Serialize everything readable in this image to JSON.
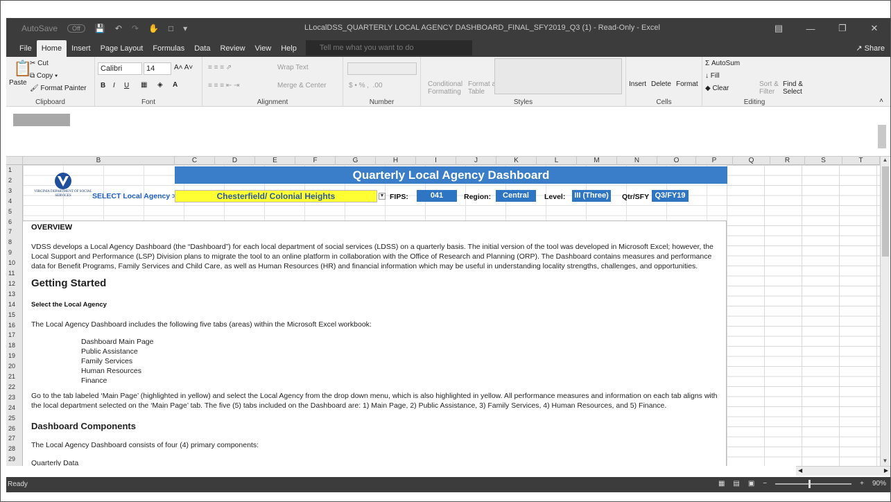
{
  "window": {
    "autosave_label": "AutoSave",
    "autosave_state": "Off",
    "title": "LLocalDSS_QUARTERLY LOCAL AGENCY DASHBOARD_FINAL_SFY2019_Q3 (1)  -  Read-Only  -  Excel",
    "minimize": "—",
    "restore": "❐",
    "close": "✕"
  },
  "tabs": [
    {
      "label": "File"
    },
    {
      "label": "Home"
    },
    {
      "label": "Insert"
    },
    {
      "label": "Page Layout"
    },
    {
      "label": "Formulas"
    },
    {
      "label": "Data"
    },
    {
      "label": "Review"
    },
    {
      "label": "View"
    },
    {
      "label": "Help"
    }
  ],
  "tell_me": "Tell me what you want to do",
  "share": "Share",
  "ribbon": {
    "clipboard": {
      "paste": "Paste",
      "cut": "Cut",
      "copy": "Copy",
      "format_painter": "Format Painter",
      "label": "Clipboard"
    },
    "font": {
      "name": "Calibri",
      "size": "14",
      "label": "Font"
    },
    "alignment": {
      "wrap": "Wrap Text",
      "merge": "Merge & Center",
      "label": "Alignment"
    },
    "number": {
      "label": "Number"
    },
    "styles": {
      "conditional": "Conditional Formatting",
      "format_table": "Format as Table",
      "label": "Styles"
    },
    "cells": {
      "insert": "Insert",
      "delete": "Delete",
      "format": "Format",
      "label": "Cells"
    },
    "editing": {
      "autosum": "AutoSum",
      "fill": "Fill",
      "clear": "Clear",
      "sort": "Sort & Filter",
      "find": "Find & Select",
      "label": "Editing"
    }
  },
  "columns": [
    "B",
    "C",
    "D",
    "E",
    "F",
    "G",
    "H",
    "I",
    "J",
    "K",
    "L",
    "M",
    "N",
    "O",
    "P",
    "Q",
    "R",
    "S",
    "T"
  ],
  "rows": [
    "1",
    "2",
    "3",
    "4",
    "5",
    "6",
    "7",
    "8",
    "9",
    "10",
    "11",
    "12",
    "13",
    "14",
    "15",
    "16",
    "17",
    "18",
    "19",
    "20",
    "21",
    "22",
    "23",
    "24",
    "25",
    "26",
    "27",
    "28",
    "29"
  ],
  "sheet": {
    "logo_text": "VIRGINIA DEPARTMENT OF SOCIAL SERVICES",
    "banner": "Quarterly Local Agency Dashboard",
    "select_label": "SELECT Local Agency >>>",
    "agency": "Chesterfield/ Colonial Heights",
    "fips_label": "FIPS:",
    "fips": "041",
    "region_label": "Region:",
    "region": "Central",
    "level_label": "Level:",
    "level": "III (Three)",
    "qtr_label": "Qtr/SFY",
    "qtr": "Q3/FY19"
  },
  "content": {
    "overview_title": "OVERVIEW",
    "overview_text": "VDSS develops a Local Agency Dashboard (the “Dashboard”) for each local department of social services (LDSS) on a quarterly basis.  The initial version of the tool was developed in Microsoft Excel; however, the Local Support and Performance (LSP) Division plans to migrate the tool to an online platform in collaboration with the Office of Research and Planning (ORP). The Dashboard contains measures and performance data for Benefit Programs, Family Services and Child Care, as well as Human Resources (HR) and financial information which may be useful in understanding locality strengths, challenges, and opportunities.",
    "getting_started": "Getting Started",
    "select_agency": "Select the Local Agency",
    "tabs_intro": "The Local Agency Dashboard includes the following five tabs (areas) within the Microsoft Excel workbook:",
    "tab_list": [
      "Dashboard Main Page",
      "Public Assistance",
      "Family Services",
      "Human Resources",
      "Finance"
    ],
    "goto_text": "Go to the tab labeled ‘Main Page’ (highlighted in yellow) and select the Local Agency from the drop down menu, which is also highlighted in yellow. All performance measures and information on each tab aligns with the local department selected on the ‘Main Page’ tab. The five (5) tabs included on the Dashboard are: 1) Main Page, 2) Public Assistance, 3) Family Services, 4) Human Resources, and 5) Finance.",
    "components_title": "Dashboard Components",
    "components_text": "The Local Agency Dashboard consists of four (4) primary components:",
    "quarterly_data": "Quarterly Data"
  },
  "status": {
    "ready": "Ready",
    "zoom": "90%",
    "minus": "−",
    "plus": "+"
  }
}
